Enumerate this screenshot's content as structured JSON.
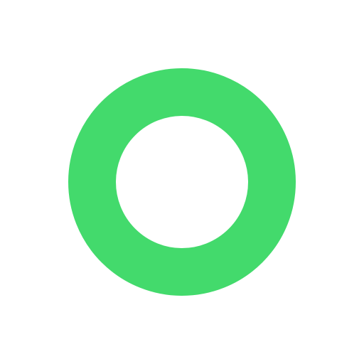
{
  "icon": {
    "name": "ring-icon",
    "shape": "ring",
    "color": "#43DA6C",
    "background": "#FFFFFF"
  }
}
